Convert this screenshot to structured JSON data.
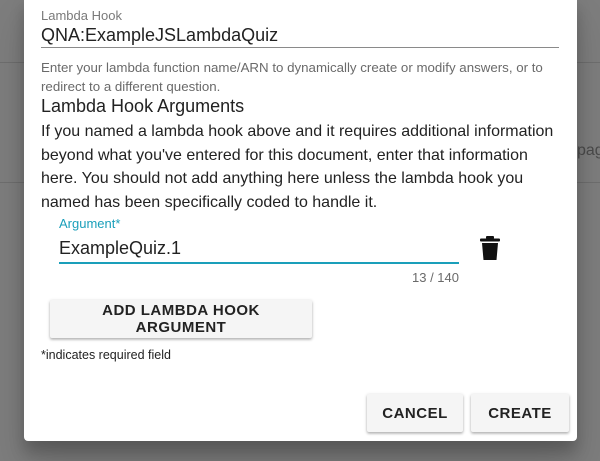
{
  "background": {
    "peek_text": "page"
  },
  "dialog": {
    "lambda_hook": {
      "label": "Lambda Hook",
      "value": "QNA:ExampleJSLambdaQuiz",
      "help": "Enter your lambda function name/ARN to dynamically create or modify answers, or to redirect to a different question."
    },
    "args_section": {
      "title": "Lambda Hook Arguments",
      "description": "If you named a lambda hook above and it requires additional information beyond what you've entered for this document, enter that information here. You should not add anything here unless the lambda hook you named has been specifically coded to handle it."
    },
    "argument": {
      "label": "Argument*",
      "value": "ExampleQuiz.1",
      "counter": "13 / 140",
      "delete_icon": "trash-icon"
    },
    "add_button": "ADD LAMBDA HOOK ARGUMENT",
    "required_note": "*indicates required field",
    "actions": {
      "cancel": "CANCEL",
      "create": "CREATE"
    }
  },
  "colors": {
    "accent": "#1a9fba",
    "backdrop": "#7d7d7d",
    "button_bg": "#f5f5f5"
  }
}
